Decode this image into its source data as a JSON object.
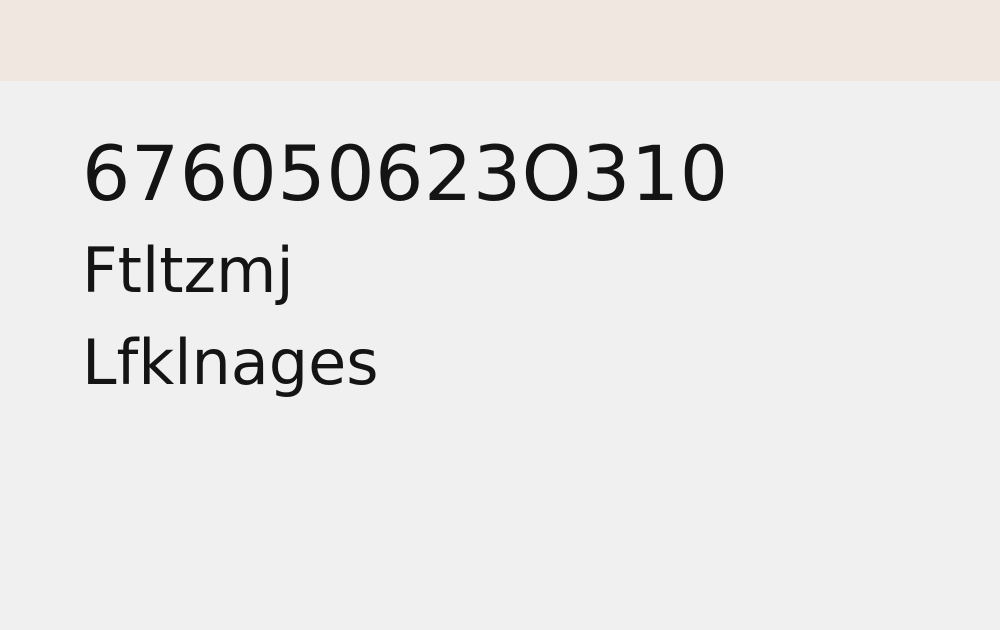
{
  "content": {
    "number": "676050623O310",
    "name": "Ftltzmj",
    "category": "Lfklnages"
  },
  "colors": {
    "top_bar": "#f0e8e0",
    "background": "#f0f0f0",
    "text": "#141414"
  }
}
